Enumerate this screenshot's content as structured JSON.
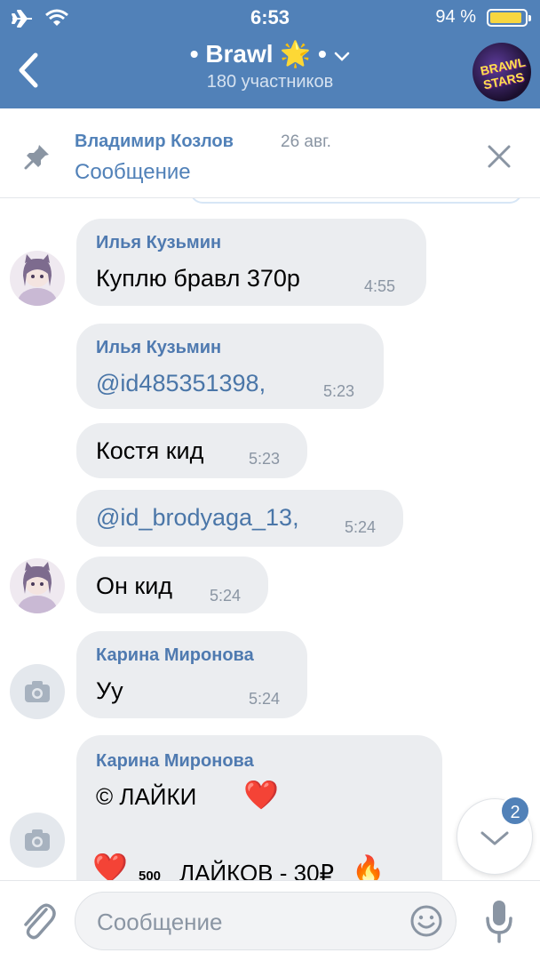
{
  "status_bar": {
    "time": "6:53",
    "battery": "94 %",
    "battery_level": 0.94
  },
  "header": {
    "title": "• Brawl 🌟 •",
    "subtitle": "180 участников",
    "avatar_logo": "BRAWL STARS"
  },
  "pinned": {
    "author": "Владимир Козлов",
    "date": "26 авг.",
    "text": "Сообщение"
  },
  "messages": [
    {
      "author": "Илья Кузьмин",
      "text": "Куплю бравл 370р",
      "time": "4:55"
    },
    {
      "author": "Илья Кузьмин",
      "text": "@id485351398,",
      "time": "5:23"
    },
    {
      "text": "Костя кид",
      "time": "5:23"
    },
    {
      "text": "@id_brodyaga_13,",
      "time": "5:24"
    },
    {
      "text": "Он кид",
      "time": "5:24"
    },
    {
      "author": "Карина Миронова",
      "text": "Уу",
      "time": "5:24"
    },
    {
      "author": "Карина Миронова",
      "line1": "© лайки",
      "line1_emoji": "❤️",
      "line3_heart": "❤️",
      "line3_small": "500",
      "line3_text": "лайков - 30₽",
      "line3_emoji": "🔥"
    }
  ],
  "scroll_down": {
    "badge": "2"
  },
  "composer": {
    "placeholder": "Сообщение"
  },
  "colors": {
    "header": "#5181b8",
    "bubble": "#ebedf0",
    "author": "#4f7ab0",
    "link": "#4a76a8"
  }
}
